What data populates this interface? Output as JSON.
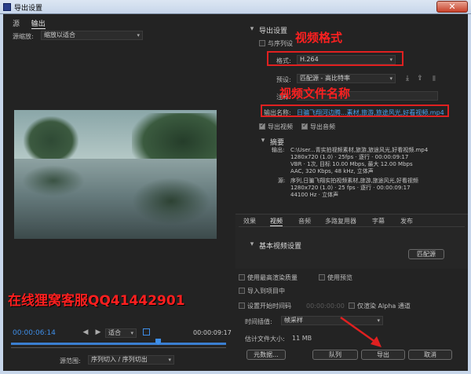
{
  "window": {
    "title": "导出设置",
    "close_glyph": "✕"
  },
  "left": {
    "tabs": [
      "源",
      "输出"
    ],
    "scale_label": "源缩放:",
    "scale_value": "缩放以适合",
    "timecode_in": "00:00:06:14",
    "timecode_out": "00:00:09:17",
    "fit_value": "适合",
    "source_range_label": "源范围:",
    "source_range_value": "序列切入 / 序列切出"
  },
  "watermark": "在线狸窝客服QQ41442901",
  "export": {
    "header": "导出设置",
    "match_sequence": "与序列设",
    "format_label": "格式:",
    "format_value": "H.264",
    "preset_label": "预设:",
    "preset_value": "匹配源 - 高比特率",
    "comment_label": "注释:",
    "output_name_label": "输出名称:",
    "output_name_value": "日骗飞翔河边腾...素材,旅游,旅途风光,好看视频.mp4",
    "export_video": "导出视频",
    "export_audio": "导出音频",
    "summary_header": "摘要",
    "output_label": "输出:",
    "output_lines": [
      "C:\\User...青实拍视频素材,旅游,旅途风光,好看视频.mp4",
      "1280x720 (1.0) · 25fps · 逐行 · 00:00:09:17",
      "VBR · 1次, 目标 10.00 Mbps, 最大 12.00 Mbps",
      "AAC, 320 Kbps, 48 kHz, 立体声"
    ],
    "source_label": "源:",
    "source_lines": [
      "序列,日骗飞翔实拍视频素材,旅游,旅途风光,好看视频",
      "1280x720 (1.0) · 25 fps · 逐行 · 00:00:09:17",
      "44100 Hz · 立体声"
    ]
  },
  "annotations": {
    "format": "视频格式",
    "filename": "视频文件名称"
  },
  "panel_tabs": [
    "效果",
    "视频",
    "音频",
    "多路复用器",
    "字幕",
    "发布"
  ],
  "basic_video": {
    "header": "基本视频设置",
    "match_source": "匹配源"
  },
  "options": {
    "max_render": "使用最高渲染质量",
    "use_preview": "使用预览",
    "import_project": "导入到项目中",
    "set_start_tc": "设置开始时间码",
    "start_tc_value": "00:00:00:00",
    "render_alpha": "仅渲染 Alpha 通道",
    "interp_label": "时间插值:",
    "interp_value": "帧采样",
    "filesize_label": "估计文件大小:",
    "filesize_value": "11 MB"
  },
  "buttons": {
    "metadata": "元数据...",
    "queue": "队列",
    "export": "导出",
    "cancel": "取消"
  }
}
